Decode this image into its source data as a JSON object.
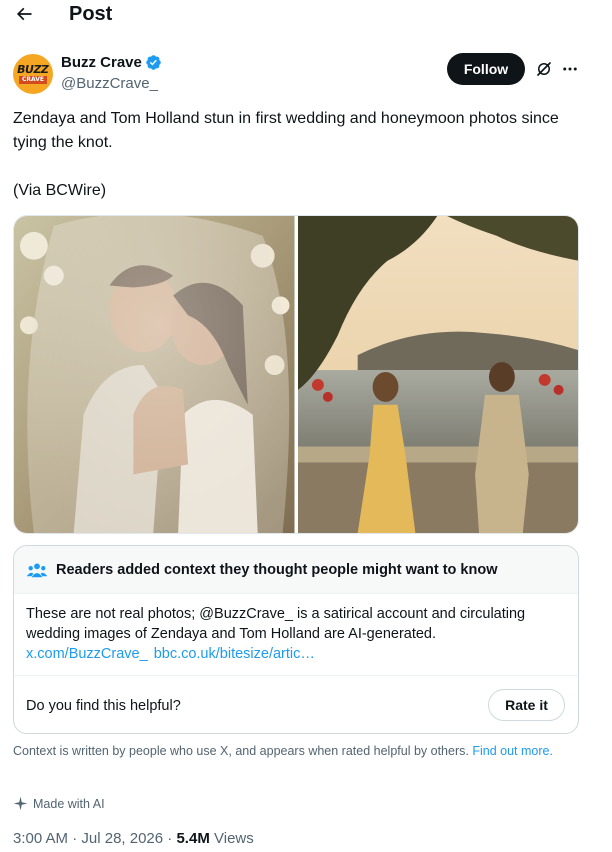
{
  "header": {
    "title": "Post"
  },
  "author": {
    "name": "Buzz Crave",
    "handle": "@BuzzCrave_",
    "avatar_text_top": "BUZZ",
    "avatar_text_bottom": "CRAVE",
    "verified": true,
    "follow_label": "Follow"
  },
  "tweet": {
    "text": "Zendaya and Tom Holland stun in first wedding and honeymoon photos since tying the knot.",
    "via": "(Via BCWire)"
  },
  "community_note": {
    "title": "Readers added context they thought people might want to know",
    "body": "These are not real photos; @BuzzCrave_ is a satirical account and circulating wedding images of Zendaya and Tom Holland are AI-generated.",
    "links": [
      "x.com/BuzzCrave_",
      "bbc.co.uk/bitesize/artic…"
    ],
    "question": "Do you find this helpful?",
    "rate_label": "Rate it"
  },
  "context_footer": {
    "text": "Context is written by people who use X, and appears when rated helpful by others.",
    "link": "Find out more."
  },
  "made_with_ai": "Made with AI",
  "meta": {
    "time": "3:00 AM",
    "date": "Jul 28, 2026",
    "views": "5.4M",
    "views_label": "Views"
  },
  "colors": {
    "accent": "#1d9bf0",
    "text": "#0f1419",
    "muted": "#536471"
  }
}
